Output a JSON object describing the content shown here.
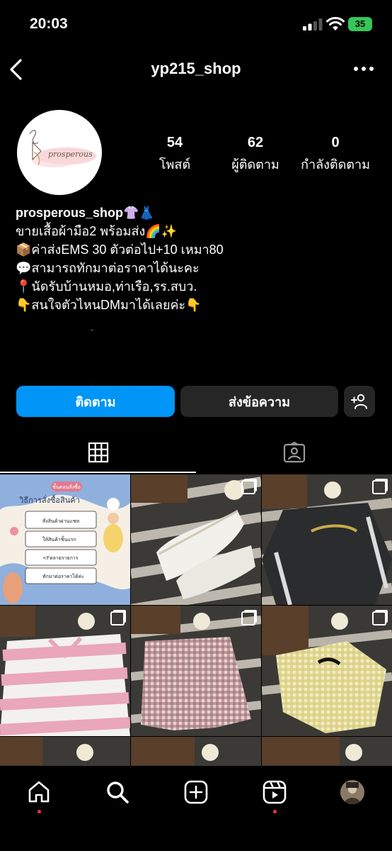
{
  "status_bar": {
    "time": "20:03",
    "battery": "35"
  },
  "nav": {
    "username": "yp215_shop"
  },
  "avatar": {
    "logo_text": "prosperous"
  },
  "stats": [
    {
      "value": "54",
      "label": "โพสต์"
    },
    {
      "value": "62",
      "label": "ผู้ติดตาม"
    },
    {
      "value": "0",
      "label": "กำลังติดตาม"
    }
  ],
  "bio": {
    "name": "prosperous_shop👚👗",
    "lines": [
      "ขายเสื้อผ้ามือ2 พร้อมส่ง🌈✨",
      "📦ค่าส่งEMS 30 ตัวต่อไป+10 เหมา80",
      "💬สามารถทักมาต่อราคาได้นะคะ",
      "📍นัดรับบ้านหมอ,ท่าเรือ,รร.สบว.",
      "👇สนใจตัวไหนDMมาได้เลยค่ะ👇"
    ]
  },
  "buttons": {
    "follow": "ติดตาม",
    "message": "ส่งข้อความ"
  },
  "post_1": {
    "badge": "ขั้นตอนสั่งซื้อ",
    "title": "วิธีการสั่งซื้อสินค้า",
    "steps": [
      "สั่งสินค้าผ่านแชท",
      "ให้สินค้าชิ้นแรก",
      "<Fหลายรายการ",
      "ทักมาต่อราคาได้ค่ะ"
    ]
  },
  "colors": {
    "accent": "#0095f6",
    "secondary_button": "#262626",
    "battery": "#34c759",
    "notification_dot": "#ff3040"
  },
  "icons": [
    "back-icon",
    "more-icon",
    "add-user-icon",
    "grid-icon",
    "tagged-icon",
    "home-icon",
    "search-icon",
    "create-icon",
    "reels-icon",
    "profile-avatar"
  ]
}
